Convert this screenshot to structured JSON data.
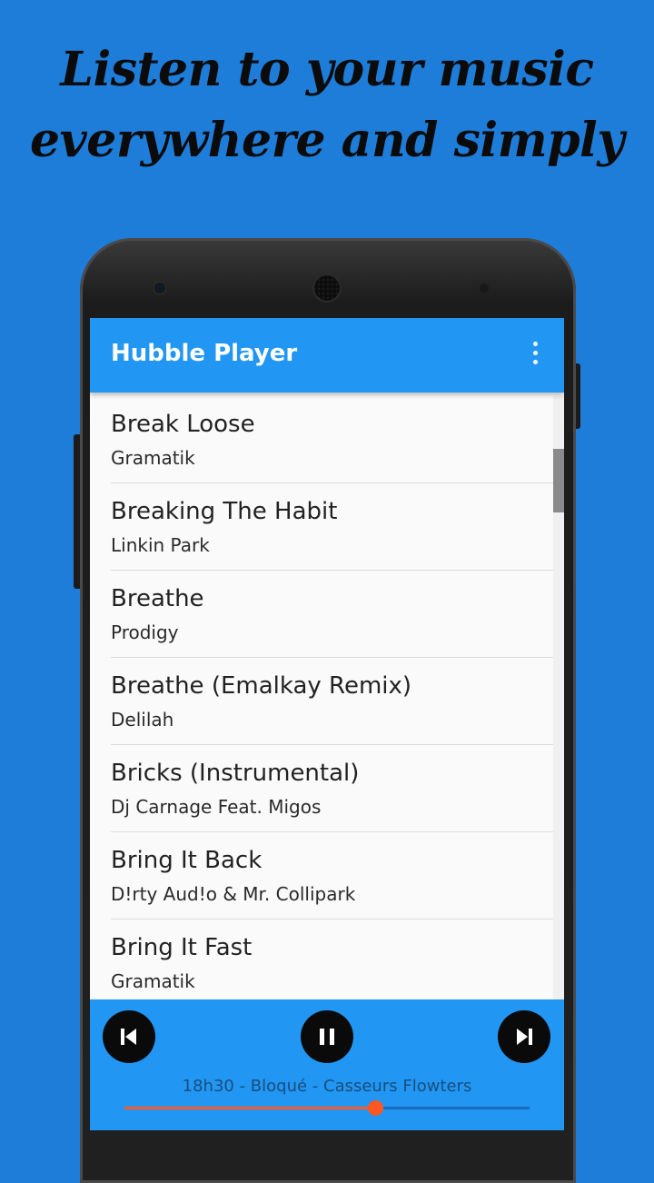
{
  "promo": {
    "line1": "Listen to your music",
    "line2": "everywhere and simply"
  },
  "app": {
    "title": "Hubble Player",
    "menu_icon": "more-vert-icon",
    "accent_color": "#2196f3"
  },
  "songs": [
    {
      "title": "Break Loose",
      "artist": "Gramatik"
    },
    {
      "title": "Breaking The Habit",
      "artist": "Linkin Park"
    },
    {
      "title": "Breathe",
      "artist": "Prodigy"
    },
    {
      "title": "Breathe (Emalkay Remix)",
      "artist": "Delilah"
    },
    {
      "title": "Bricks (Instrumental)",
      "artist": "Dj Carnage Feat. Migos"
    },
    {
      "title": "Bring It Back",
      "artist": "D!rty Aud!o & Mr. Collipark"
    },
    {
      "title": "Bring It Fast",
      "artist": "Gramatik"
    }
  ],
  "player": {
    "now_playing": "18h30 - Bloqué - Casseurs Flowters",
    "progress": 0.62,
    "prev_icon": "skip-previous-icon",
    "pause_icon": "pause-icon",
    "next_icon": "skip-next-icon",
    "seek_color": "#ff5722"
  }
}
